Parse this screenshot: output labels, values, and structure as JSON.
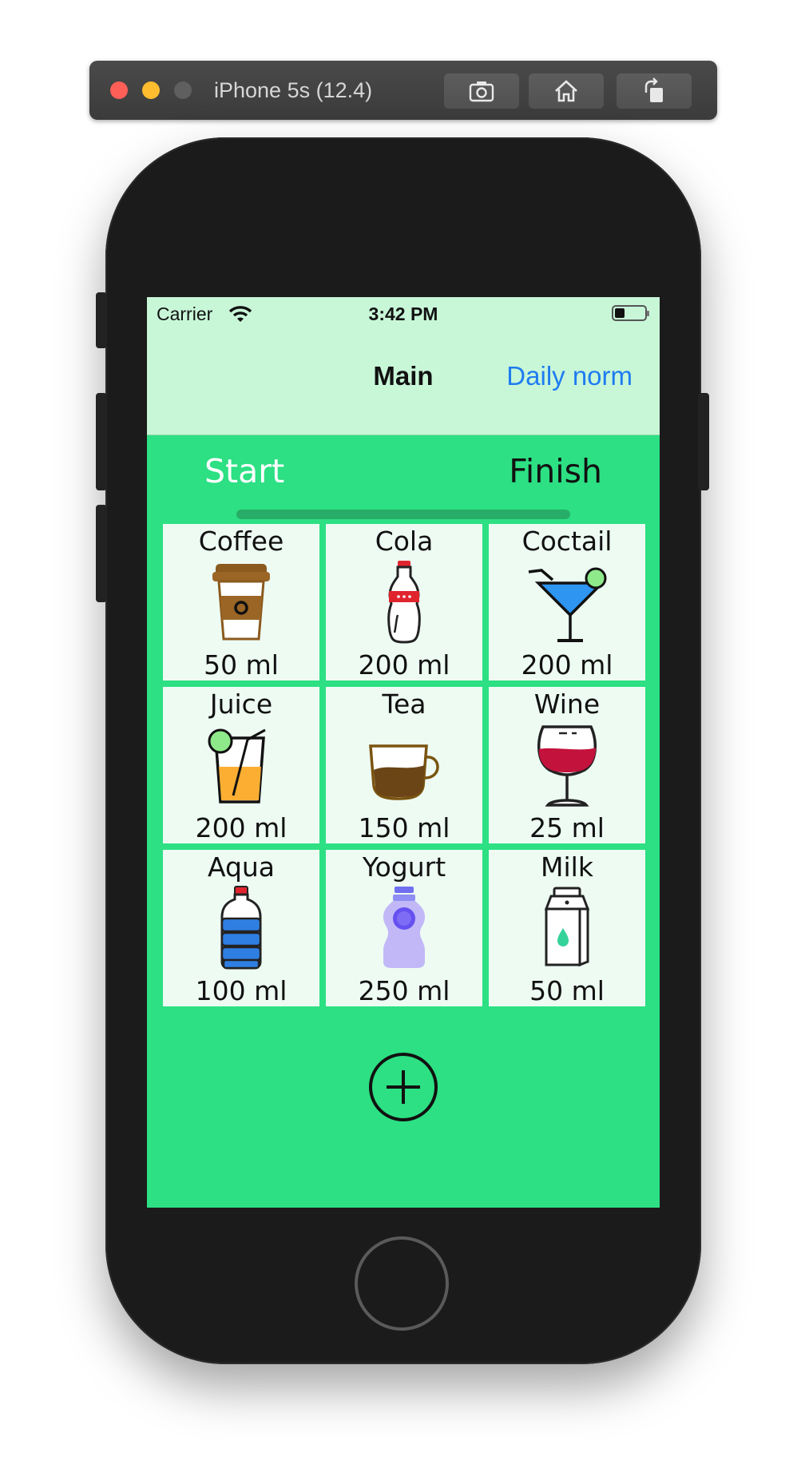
{
  "simulator": {
    "title": "iPhone 5s (12.4)",
    "buttons": [
      {
        "icon": "screenshot-camera-icon"
      },
      {
        "icon": "home-icon"
      },
      {
        "icon": "rotate-icon"
      }
    ]
  },
  "status_bar": {
    "carrier": "Carrier",
    "time": "3:42 PM"
  },
  "nav": {
    "title": "Main",
    "right_button": "Daily norm"
  },
  "progress": {
    "start_label": "Start",
    "finish_label": "Finish",
    "value": 0
  },
  "drinks": [
    {
      "name": "Coffee",
      "amount": "50 ml",
      "icon": "coffee-cup-icon"
    },
    {
      "name": "Cola",
      "amount": "200 ml",
      "icon": "cola-bottle-icon"
    },
    {
      "name": "Coctail",
      "amount": "200 ml",
      "icon": "cocktail-glass-icon"
    },
    {
      "name": "Juice",
      "amount": "200 ml",
      "icon": "juice-glass-icon"
    },
    {
      "name": "Tea",
      "amount": "150 ml",
      "icon": "tea-cup-icon"
    },
    {
      "name": "Wine",
      "amount": "25 ml",
      "icon": "wine-glass-icon"
    },
    {
      "name": "Aqua",
      "amount": "100 ml",
      "icon": "water-bottle-icon"
    },
    {
      "name": "Yogurt",
      "amount": "250 ml",
      "icon": "yogurt-bottle-icon"
    },
    {
      "name": "Milk",
      "amount": "50 ml",
      "icon": "milk-carton-icon"
    }
  ],
  "add_button": {
    "icon": "plus-circle-icon"
  },
  "colors": {
    "screen_background": "#2ce083",
    "nav_background": "#c8f7d8",
    "cell_background": "#edfbf3",
    "link_blue": "#1f7cf0"
  }
}
